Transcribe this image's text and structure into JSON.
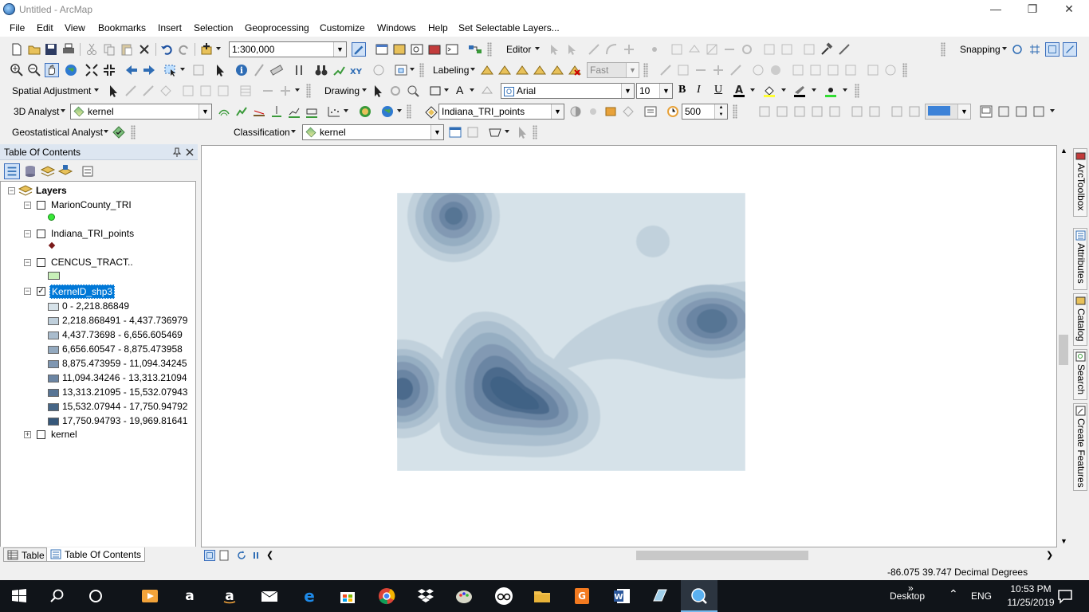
{
  "window": {
    "title": "Untitled - ArcMap"
  },
  "menu": [
    "File",
    "Edit",
    "View",
    "Bookmarks",
    "Insert",
    "Selection",
    "Geoprocessing",
    "Customize",
    "Windows",
    "Help",
    "Set Selectable Layers..."
  ],
  "toolbar1": {
    "scale": "1:300,000",
    "editor": "Editor",
    "snapping": "Snapping"
  },
  "toolbar2": {
    "labeling": "Labeling",
    "quality": "Fast"
  },
  "toolbar3": {
    "spatial_adjustment": "Spatial Adjustment",
    "drawing": "Drawing",
    "font": "Arial",
    "font_size": "10",
    "bold": "B",
    "italic": "I",
    "underline": "U",
    "text_tool": "A"
  },
  "toolbar4": {
    "analyst3d": "3D Analyst",
    "layer": "kernel",
    "target_layer": "Indiana_TRI_points",
    "resolution": "500"
  },
  "toolbar5": {
    "geostat": "Geostatistical Analyst",
    "classification": "Classification",
    "layer": "kernel"
  },
  "toc": {
    "title": "Table Of Contents",
    "root": "Layers",
    "layers": [
      {
        "name": "MarionCounty_TRI",
        "checked": false
      },
      {
        "name": "Indiana_TRI_points",
        "checked": false
      },
      {
        "name": "CENCUS_TRACT..",
        "checked": false
      },
      {
        "name": "KernelD_shp3",
        "checked": true
      },
      {
        "name": "kernel",
        "checked": false
      }
    ],
    "legend": [
      {
        "label": "0 - 2,218.86849",
        "color": "#d6e2e9"
      },
      {
        "label": "2,218.868491 - 4,437.736979",
        "color": "#bfcfdb"
      },
      {
        "label": "4,437.73698 - 6,656.605469",
        "color": "#a9bccd"
      },
      {
        "label": "6,656.60547 - 8,875.473958",
        "color": "#93a9bf"
      },
      {
        "label": "8,875.473959 - 11,094.34245",
        "color": "#7e96b1"
      },
      {
        "label": "11,094.34246 - 13,313.21094",
        "color": "#6b85a3"
      },
      {
        "label": "13,313.21095 - 15,532.07943",
        "color": "#587595"
      },
      {
        "label": "15,532.07944 - 17,750.94792",
        "color": "#466687"
      },
      {
        "label": "17,750.94793 - 19,969.81641",
        "color": "#36587a"
      }
    ],
    "tabs": [
      "Table",
      "Table Of Contents"
    ]
  },
  "dock_tabs": [
    "ArcToolbox",
    "Attributes",
    "Catalog",
    "Search",
    "Create Features"
  ],
  "status": {
    "coords": "-86.075  39.747 Decimal Degrees"
  },
  "taskbar": {
    "desktop": "Desktop",
    "lang": "ENG",
    "time": "10:53 PM",
    "date": "11/25/2019"
  },
  "colors": {
    "selection": "#0078d7",
    "accent": "#1a5ea8"
  }
}
